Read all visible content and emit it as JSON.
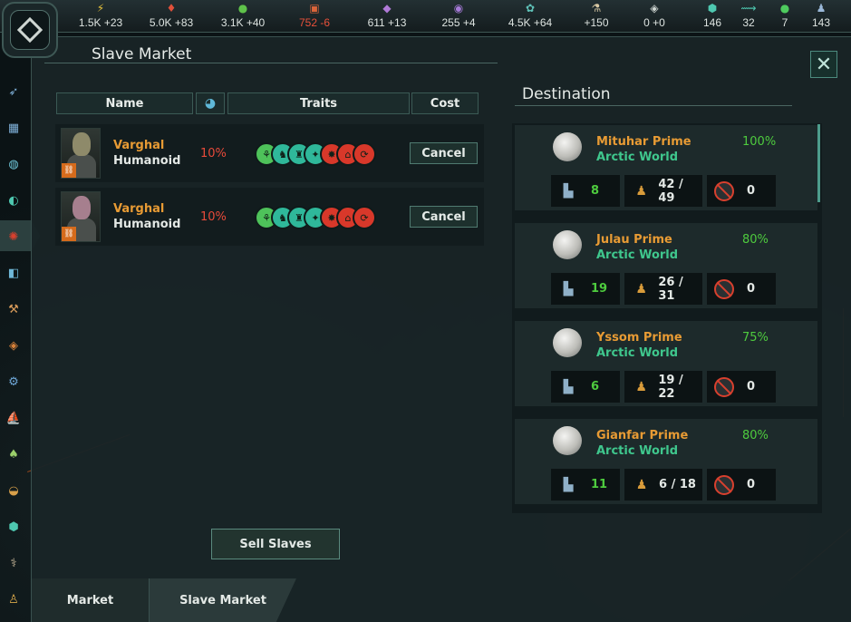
{
  "resources": [
    {
      "icon": "energy-icon",
      "glyph": "⚡",
      "color": "#e8c23a",
      "value": "1.5K +23"
    },
    {
      "icon": "minerals-icon",
      "glyph": "♦",
      "color": "#e0503a",
      "value": "5.0K +83"
    },
    {
      "icon": "food-icon",
      "glyph": "●",
      "color": "#5fc24a",
      "value": "3.1K +40"
    },
    {
      "icon": "consumer-goods-icon",
      "glyph": "▣",
      "color": "#d9643a",
      "value": "752 -6",
      "negative": true
    },
    {
      "icon": "alloys-icon",
      "glyph": "◆",
      "color": "#b07ad8",
      "value": "611 +13"
    },
    {
      "icon": "influence-icon",
      "glyph": "◉",
      "color": "#a67ad8",
      "value": "255 +4"
    },
    {
      "icon": "unity-icon",
      "glyph": "✿",
      "color": "#5fc2b8",
      "value": "4.5K +64"
    },
    {
      "icon": "research-icon",
      "glyph": "⚗",
      "color": "#d9c9a4",
      "value": "+150"
    },
    {
      "icon": "trade-icon",
      "glyph": "◈",
      "color": "#cfd6d2",
      "value": "0 +0"
    },
    {
      "icon": "sector-icon",
      "glyph": "⬢",
      "color": "#4ec8b0",
      "value": "146"
    },
    {
      "icon": "systems-icon",
      "glyph": "⟿",
      "color": "#4ec8b0",
      "value": "32"
    },
    {
      "icon": "planets-icon",
      "glyph": "●",
      "color": "#4ecb5e",
      "value": "7"
    },
    {
      "icon": "pops-icon",
      "glyph": "♟",
      "color": "#9ab8d8",
      "value": "143"
    }
  ],
  "window": {
    "title": "Slave Market",
    "close_glyph": "✕"
  },
  "list": {
    "headers": {
      "name": "Name",
      "traits": "Traits",
      "cost": "Cost"
    },
    "rows": [
      {
        "name": "Varghal",
        "species": "Humanoid",
        "percent": "10%",
        "cancel": "Cancel"
      },
      {
        "name": "Varghal",
        "species": "Humanoid",
        "percent": "10%",
        "cancel": "Cancel"
      }
    ],
    "traits": [
      {
        "icon": "trait-agrarian-icon",
        "color": "#4ec25a",
        "glyph": "⚘"
      },
      {
        "icon": "trait-strong-icon",
        "color": "#2fb89a",
        "glyph": "♞"
      },
      {
        "icon": "trait-nomadic-icon",
        "color": "#2fb89a",
        "glyph": "♜"
      },
      {
        "icon": "trait-intelligent-icon",
        "color": "#2fb89a",
        "glyph": "✦"
      },
      {
        "icon": "trait-repugnant-icon",
        "color": "#d8382a",
        "glyph": "✸"
      },
      {
        "icon": "trait-sedentary-icon",
        "color": "#d8382a",
        "glyph": "⌂"
      },
      {
        "icon": "trait-unruly-icon",
        "color": "#d8382a",
        "glyph": "⟳"
      }
    ],
    "sell_button": "Sell Slaves"
  },
  "destination": {
    "title": "Destination",
    "planets": [
      {
        "name": "Mituhar Prime",
        "type": "Arctic World",
        "percent": "100%",
        "housing": "8",
        "pops": "42 / 49",
        "slaves": "0"
      },
      {
        "name": "Julau Prime",
        "type": "Arctic World",
        "percent": "80%",
        "housing": "19",
        "pops": "26 / 31",
        "slaves": "0"
      },
      {
        "name": "Yssom Prime",
        "type": "Arctic World",
        "percent": "75%",
        "housing": "6",
        "pops": "19 / 22",
        "slaves": "0"
      },
      {
        "name": "Gianfar Prime",
        "type": "Arctic World",
        "percent": "80%",
        "housing": "11",
        "pops": "6 / 18",
        "slaves": "0"
      }
    ]
  },
  "tabs": {
    "market": "Market",
    "slave_market": "Slave Market"
  }
}
